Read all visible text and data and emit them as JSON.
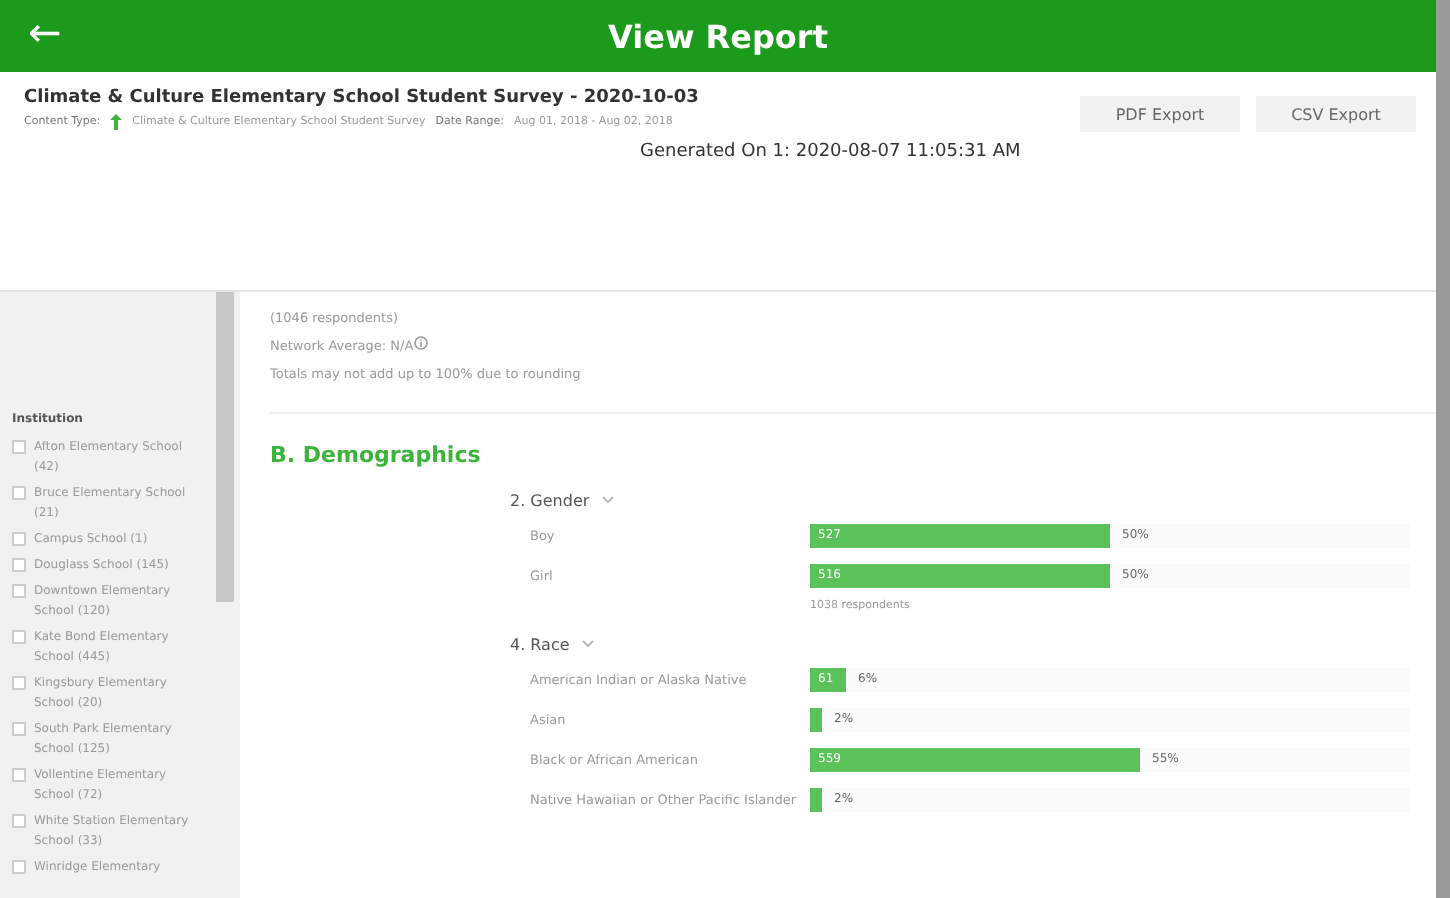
{
  "header": {
    "back_icon": "←",
    "title": "View Report"
  },
  "report": {
    "title": "Climate & Culture Elementary School Student Survey - 2020-10-03",
    "content_type_label": "Content Type:",
    "content_type": "Climate & Culture Elementary School Student Survey",
    "date_range_label": "Date Range:",
    "date_range": "Aug 01, 2018 - Aug 02, 2018",
    "generated": "Generated On 1: 2020-08-07 11:05:31 AM",
    "buttons": [
      "PDF Export",
      "CSV Export"
    ]
  },
  "sidebar": {
    "heading": "Institution",
    "items": [
      {
        "label": "Afton Elementary School (42)",
        "checked": false
      },
      {
        "label": "Bruce Elementary School (21)",
        "checked": false
      },
      {
        "label": "Campus School (1)",
        "checked": false
      },
      {
        "label": "Douglass School (145)",
        "checked": false
      },
      {
        "label": "Downtown Elementary School (120)",
        "checked": false
      },
      {
        "label": "Kate Bond Elementary School (445)",
        "checked": false
      },
      {
        "label": "Kingsbury Elementary School (20)",
        "checked": false
      },
      {
        "label": "South Park Elementary School (125)",
        "checked": false
      },
      {
        "label": "Vollentine Elementary School (72)",
        "checked": false
      },
      {
        "label": "White Station Elementary School (33)",
        "checked": false
      },
      {
        "label": "Winridge Elementary",
        "checked": false
      }
    ]
  },
  "summary": {
    "respondents": "(1046 respondents)",
    "network_average": "Network Average: N/A",
    "note": "Totals may not add up to 100% due to rounding"
  },
  "section": {
    "title": "B. Demographics",
    "questions": [
      {
        "title": "2. Gender",
        "rows": [
          {
            "label": "Boy",
            "count": "527",
            "level": 0.5,
            "percent": "50%"
          },
          {
            "label": "Girl",
            "count": "516",
            "level": 0.5,
            "percent": "50%"
          }
        ],
        "respondents": "1038 respondents"
      },
      {
        "title": "4. Race",
        "rows": [
          {
            "label": "American Indian or Alaska Native",
            "count": "61",
            "level": 0.06,
            "percent": "6%"
          },
          {
            "label": "Asian",
            "level": 0.02,
            "percent": "2%"
          },
          {
            "label": "Black or African American",
            "count": "559",
            "level": 0.55,
            "percent": "55%"
          },
          {
            "label": "Native Hawaiian or Other Pacific Islander",
            "level": 0.02,
            "percent": "2%"
          }
        ]
      }
    ]
  }
}
